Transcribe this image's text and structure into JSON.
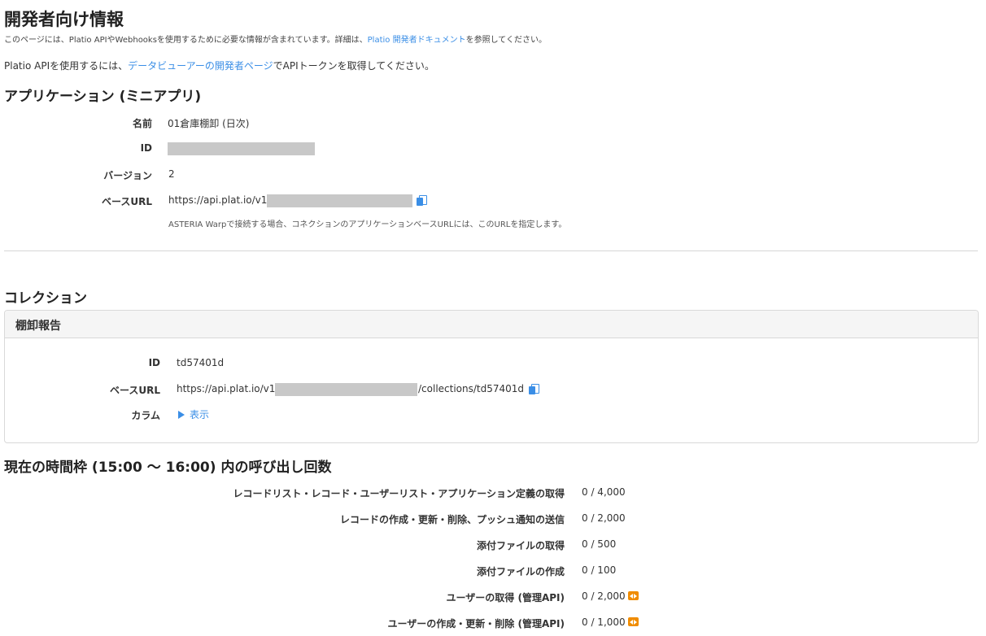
{
  "page": {
    "title": "開発者向け情報",
    "desc_prefix": "このページには、Platio APIやWebhooksを使用するために必要な情報が含まれています。詳細は、",
    "desc_link": "Platio 開発者ドキュメント",
    "desc_suffix": "を参照してください。",
    "para_prefix": "Platio APIを使用するには、",
    "para_link": "データビューアーの開発者ページ",
    "para_suffix": "でAPIトークンを取得してください。"
  },
  "application": {
    "heading": "アプリケーション (ミニアプリ)",
    "name_label": "名前",
    "name_value": "01倉庫棚卸 (日次)",
    "id_label": "ID",
    "version_label": "バージョン",
    "version_value": "2",
    "base_url_label": "ベースURL",
    "base_url_prefix": "https://api.plat.io/v1/",
    "base_url_note": "ASTERIA Warpで接続する場合、コネクションのアプリケーションベースURLには、このURLを指定します。"
  },
  "collections": {
    "heading": "コレクション",
    "panel_title": "棚卸報告",
    "id_label": "ID",
    "id_value": "td57401d",
    "base_url_label": "ベースURL",
    "base_url_prefix": "https://api.plat.io/v1/",
    "base_url_suffix": "/collections/td57401d",
    "columns_label": "カラム",
    "columns_toggle": "表示"
  },
  "quota": {
    "heading": "現在の時間枠 (15:00 〜 16:00) 内の呼び出し回数",
    "rows": [
      {
        "label": "レコードリスト・レコード・ユーザーリスト・アプリケーション定義の取得",
        "value": "0 / 4,000"
      },
      {
        "label": "レコードの作成・更新・削除、プッシュ通知の送信",
        "value": "0 / 2,000"
      },
      {
        "label": "添付ファイルの取得",
        "value": "0 / 500"
      },
      {
        "label": "添付ファイルの作成",
        "value": "0 / 100"
      },
      {
        "label": "ユーザーの取得 (管理API)",
        "value": "0 / 2,000"
      },
      {
        "label": "ユーザーの作成・更新・削除 (管理API)",
        "value": "0 / 1,000"
      }
    ]
  },
  "colors": {
    "link": "#3a8ee6",
    "badge": "#f08c00",
    "redaction": "#c8c8c8"
  }
}
